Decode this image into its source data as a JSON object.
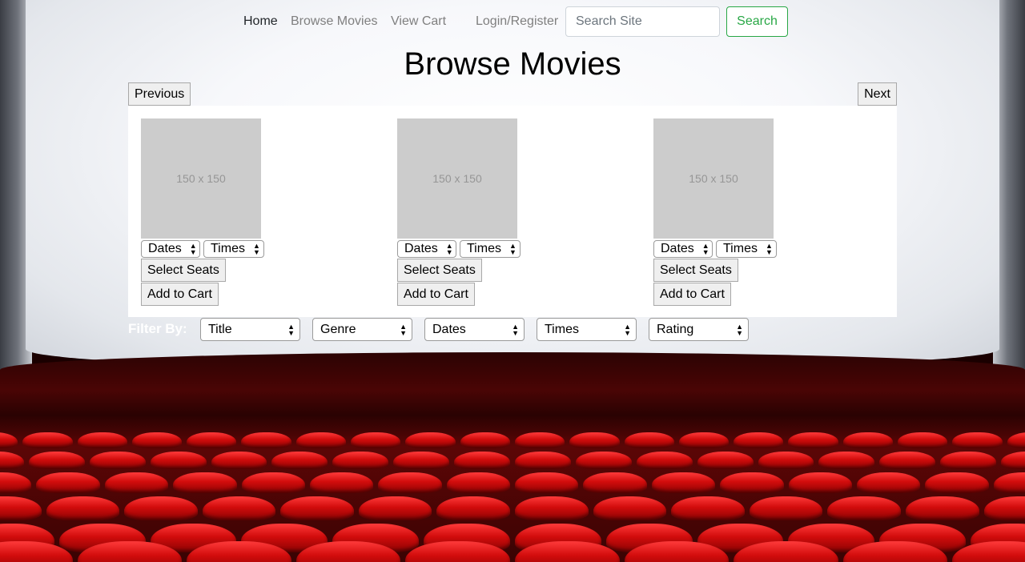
{
  "nav": {
    "home": "Home",
    "browse_movies": "Browse Movies",
    "view_cart": "View Cart",
    "login_register": "Login/Register",
    "search_placeholder": "Search Site",
    "search_button": "Search"
  },
  "page": {
    "title": "Browse Movies",
    "previous": "Previous",
    "next": "Next"
  },
  "movies": [
    {
      "poster_label": "150 x 150",
      "dates": "Dates",
      "times": "Times",
      "select_seats": "Select Seats",
      "add_to_cart": "Add to Cart"
    },
    {
      "poster_label": "150 x 150",
      "dates": "Dates",
      "times": "Times",
      "select_seats": "Select Seats",
      "add_to_cart": "Add to Cart"
    },
    {
      "poster_label": "150 x 150",
      "dates": "Dates",
      "times": "Times",
      "select_seats": "Select Seats",
      "add_to_cart": "Add to Cart"
    }
  ],
  "filter": {
    "label": "Filter By:",
    "options": [
      "Title",
      "Genre",
      "Dates",
      "Times",
      "Rating"
    ]
  },
  "colors": {
    "search_accent": "#28a745",
    "seat_red": "#d20c0c"
  }
}
